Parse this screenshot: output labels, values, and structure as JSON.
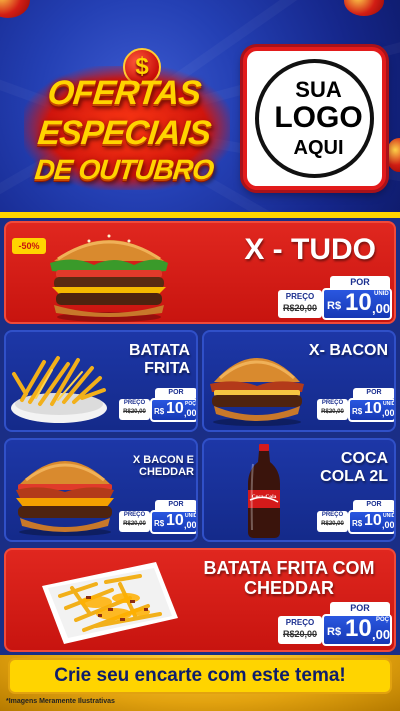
{
  "header": {
    "title_line1": "OFERTAS",
    "title_line2": "ESPECIAIS",
    "title_line3": "DE OUTUBRO",
    "badge_symbol": "$",
    "logo_line1": "SUA",
    "logo_line2": "LOGO",
    "logo_line3": "AQUI"
  },
  "colors": {
    "brand_blue": "#1a2e86",
    "accent_red": "#d81b14",
    "accent_yellow": "#ffd400"
  },
  "products": [
    {
      "name": "X - TUDO",
      "discount_badge": "-50%",
      "por": "POR",
      "preco": "PREÇO",
      "old_price": "R$20,00",
      "currency": "R$",
      "price_int": "10",
      "price_dec": ",00",
      "unit": "UNID"
    },
    {
      "name": "BATATA FRITA",
      "por": "POR",
      "preco": "PREÇO",
      "old_price": "R$20,00",
      "currency": "R$",
      "price_int": "10",
      "price_dec": ",00",
      "unit": "POÇ"
    },
    {
      "name": "X- BACON",
      "por": "POR",
      "preco": "PREÇO",
      "old_price": "R$20,00",
      "currency": "R$",
      "price_int": "10",
      "price_dec": ",00",
      "unit": "UNID"
    },
    {
      "name": "X BACON E CHEDDAR",
      "por": "POR",
      "preco": "PREÇO",
      "old_price": "R$20,00",
      "currency": "R$",
      "price_int": "10",
      "price_dec": ",00",
      "unit": "UNID"
    },
    {
      "name": "COCA COLA 2L",
      "por": "POR",
      "preco": "PREÇO",
      "old_price": "R$20,00",
      "currency": "R$",
      "price_int": "10",
      "price_dec": ",00",
      "unit": "UNID"
    },
    {
      "name": "BATATA FRITA COM CHEDDAR",
      "por": "POR",
      "preco": "PREÇO",
      "old_price": "R$20,00",
      "currency": "R$",
      "price_int": "10",
      "price_dec": ",00",
      "unit": "POÇ"
    }
  ],
  "footer": {
    "cta": "Crie seu encarte com este tema!",
    "disclaimer": "*Imagens Meramente Ilustrativas"
  },
  "art": {
    "burger": "burger-illustration",
    "fries": "fries-illustration",
    "soda": "soda-bottle-illustration",
    "cheese_fries": "cheese-fries-illustration",
    "coca_label": "Coca-Cola"
  }
}
